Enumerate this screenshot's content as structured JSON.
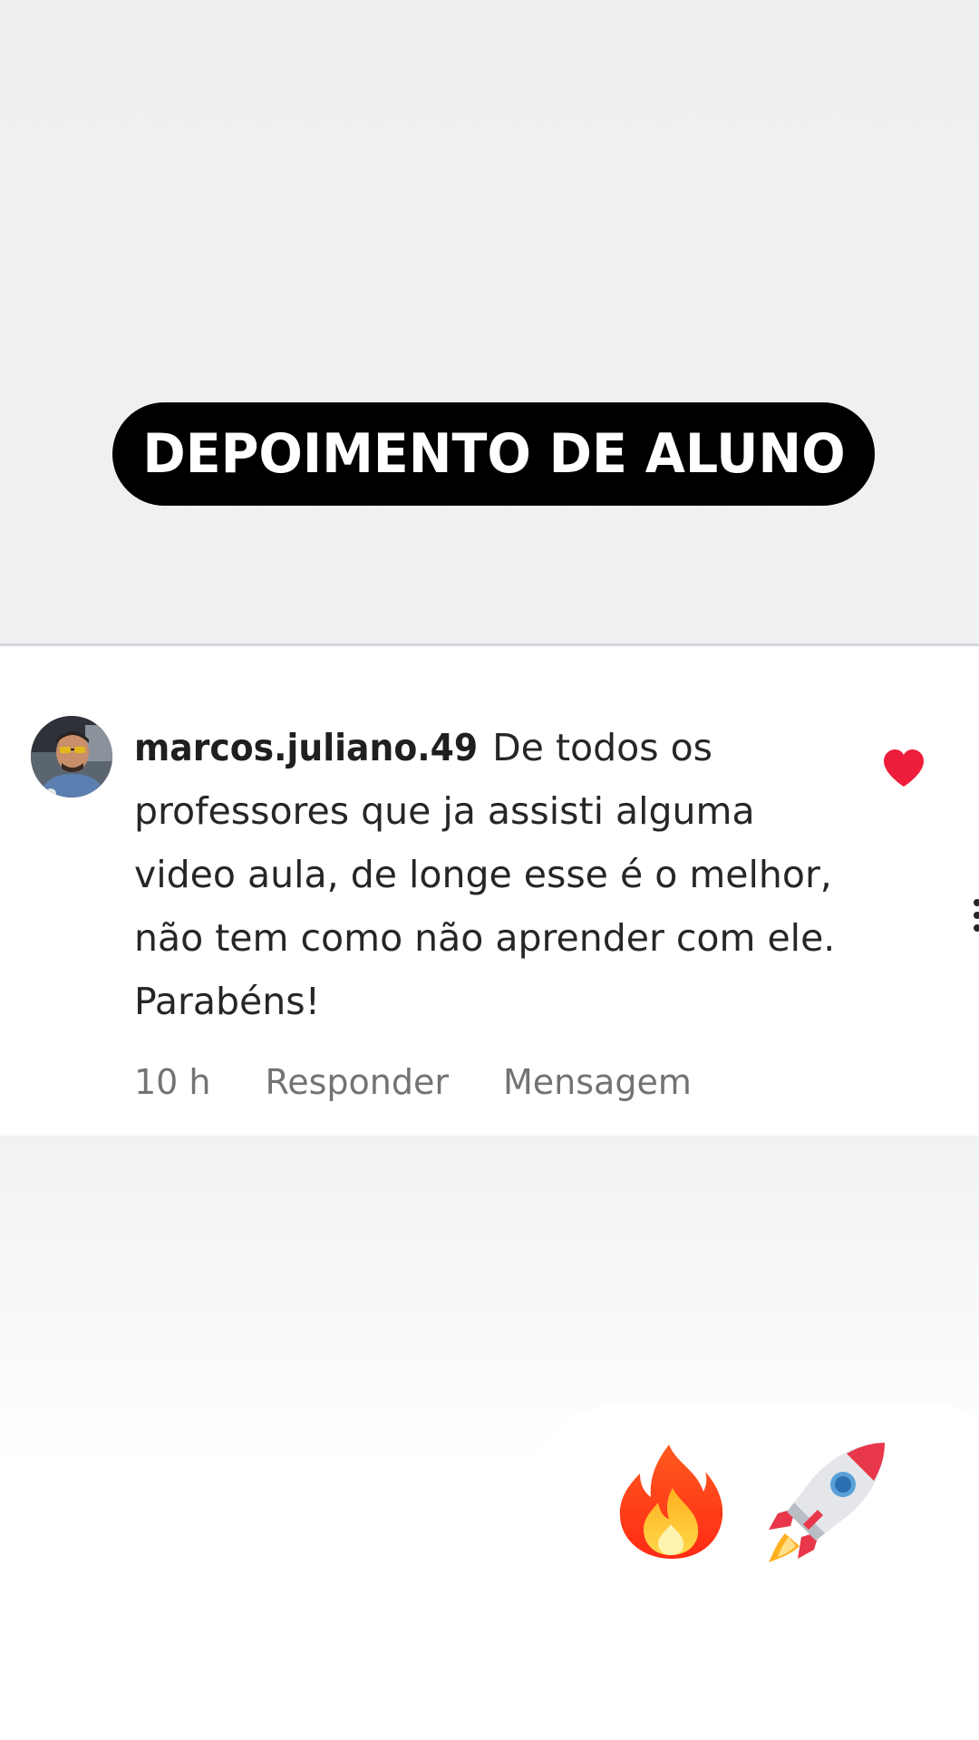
{
  "banner": {
    "title": "DEPOIMENTO DE ALUNO"
  },
  "comment": {
    "username": "marcos.juliano.49",
    "text": "De todos os professores que ja assisti alguma video aula, de longe esse é o melhor, não tem como não aprender com ele. Parabéns!",
    "time": "10 h",
    "reply_label": "Responder",
    "message_label": "Mensagem",
    "liked": true
  },
  "reactions": {
    "emojis": [
      "fire-emoji",
      "rocket-emoji"
    ]
  },
  "colors": {
    "pill_background": "#000000",
    "pill_text": "#ffffff",
    "heart": "#ee1d3b",
    "meta_text": "#737373",
    "body_text": "#262626"
  }
}
